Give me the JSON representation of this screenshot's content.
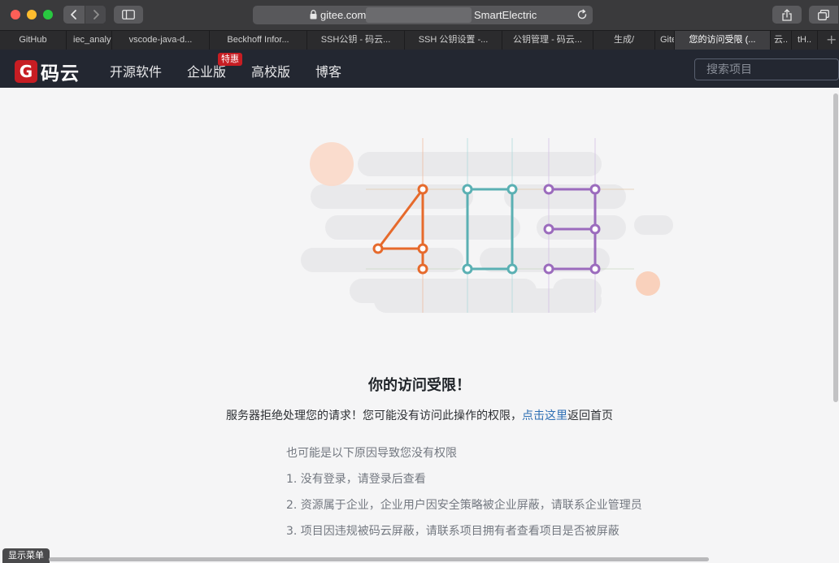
{
  "browser": {
    "address": {
      "domain": "gitee.com",
      "page_title": "SmartElectric"
    },
    "tabs": [
      {
        "label": "GitHub"
      },
      {
        "label": "iec_analy"
      },
      {
        "label": "vscode-java-d..."
      },
      {
        "label": "Beckhoff Infor..."
      },
      {
        "label": "SSH公钥 - 码云..."
      },
      {
        "label": "SSH 公钥设置 -..."
      },
      {
        "label": "公钥管理 - 码云..."
      },
      {
        "label": "生成/"
      },
      {
        "label": "Gite"
      },
      {
        "label": "您的访问受限 (..."
      },
      {
        "label": "云.."
      },
      {
        "label": "tH.."
      }
    ]
  },
  "header": {
    "logo_text": "码云",
    "nav": [
      {
        "label": "开源软件"
      },
      {
        "label": "企业版"
      },
      {
        "label": "高校版"
      },
      {
        "label": "博客"
      }
    ],
    "badge": "特惠",
    "search_placeholder": "搜索项目"
  },
  "error": {
    "code": "403",
    "title": "你的访问受限！",
    "message_before": "服务器拒绝处理您的请求！您可能没有访问此操作的权限，",
    "link": "点击这里",
    "message_after": "返回首页",
    "reasons_heading": "也可能是以下原因导致您没有权限",
    "reasons": [
      "1. 没有登录，请登录后查看",
      "2. 资源属于企业，企业用户因安全策略被企业屏蔽，请联系企业管理员",
      "3. 项目因违规被码云屏蔽，请联系项目拥有者查看项目是否被屏蔽"
    ]
  },
  "footer": {
    "menu_pill": "显示菜单"
  },
  "colors": {
    "brand_red": "#c71d23",
    "digit_4": "#e66a2c",
    "digit_0": "#5ab0b3",
    "digit_3": "#9b6bbd",
    "link": "#2e6fb4"
  }
}
